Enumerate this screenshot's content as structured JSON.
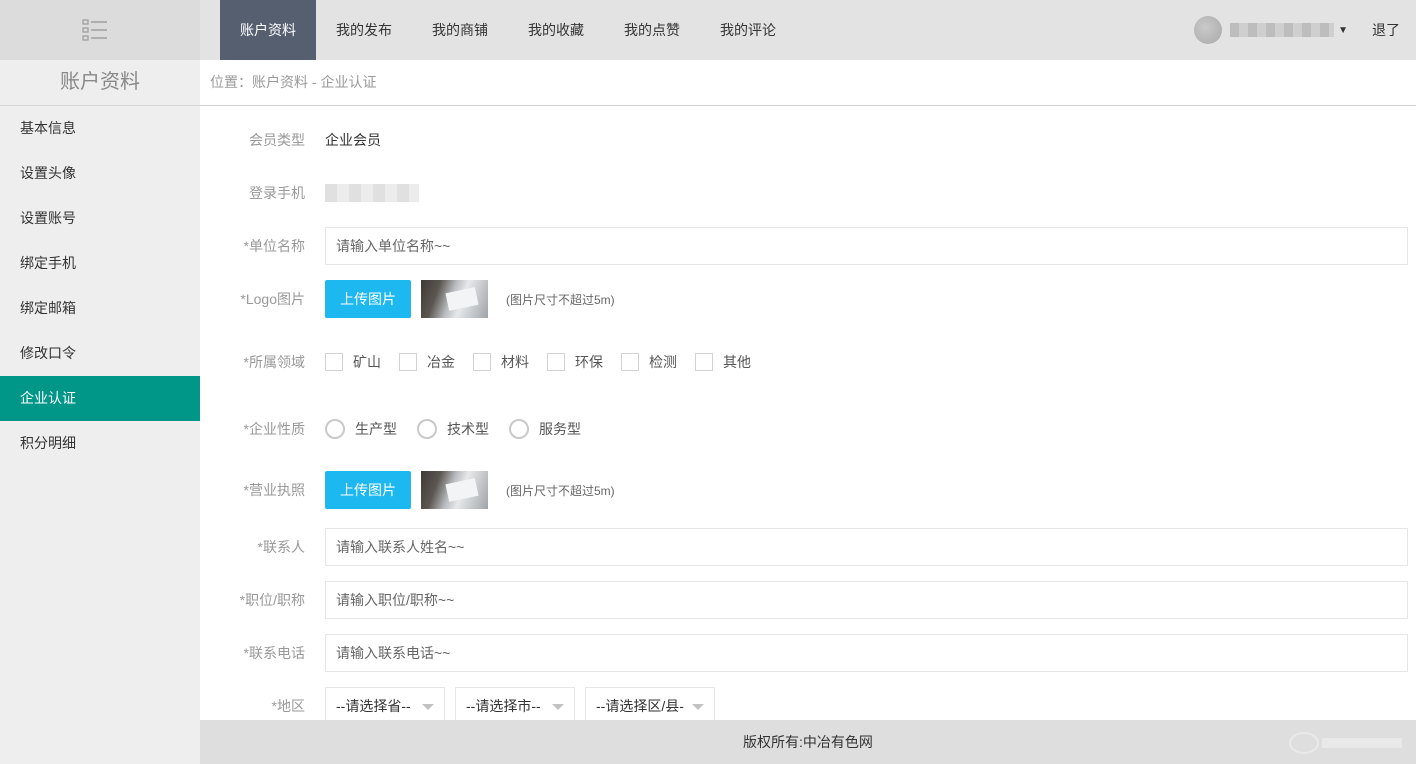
{
  "topbar": {
    "nav": [
      "账户资料",
      "我的发布",
      "我的商铺",
      "我的收藏",
      "我的点赞",
      "我的评论"
    ],
    "logout": "退了"
  },
  "sidebar": {
    "title": "账户资料",
    "items": [
      "基本信息",
      "设置头像",
      "设置账号",
      "绑定手机",
      "绑定邮箱",
      "修改口令",
      "企业认证",
      "积分明细"
    ]
  },
  "breadcrumb": "位置：账户资料 - 企业认证",
  "form": {
    "member_type_label": "会员类型",
    "member_type_value": "企业会员",
    "phone_label": "登录手机",
    "company_label": "*单位名称",
    "company_placeholder": "请输入单位名称~~",
    "logo_label": "*Logo图片",
    "upload_label": "上传图片",
    "size_hint": "(图片尺寸不超过5m)",
    "field_label": "*所属领域",
    "fields": [
      "矿山",
      "冶金",
      "材料",
      "环保",
      "检测",
      "其他"
    ],
    "nature_label": "*企业性质",
    "natures": [
      "生产型",
      "技术型",
      "服务型"
    ],
    "license_label": "*营业执照",
    "contact_label": "*联系人",
    "contact_placeholder": "请输入联系人姓名~~",
    "position_label": "*职位/职称",
    "position_placeholder": "请输入职位/职称~~",
    "tel_label": "*联系电话",
    "tel_placeholder": "请输入联系电话~~",
    "region_label": "*地区",
    "province": "--请选择省--",
    "city": "--请选择市--",
    "district": "--请选择区/县-"
  },
  "footer": "版权所有:中冶有色网",
  "colors": {
    "nav_active": "#565f70",
    "sidebar_active": "#009688",
    "upload_button": "#1eb8f0"
  }
}
